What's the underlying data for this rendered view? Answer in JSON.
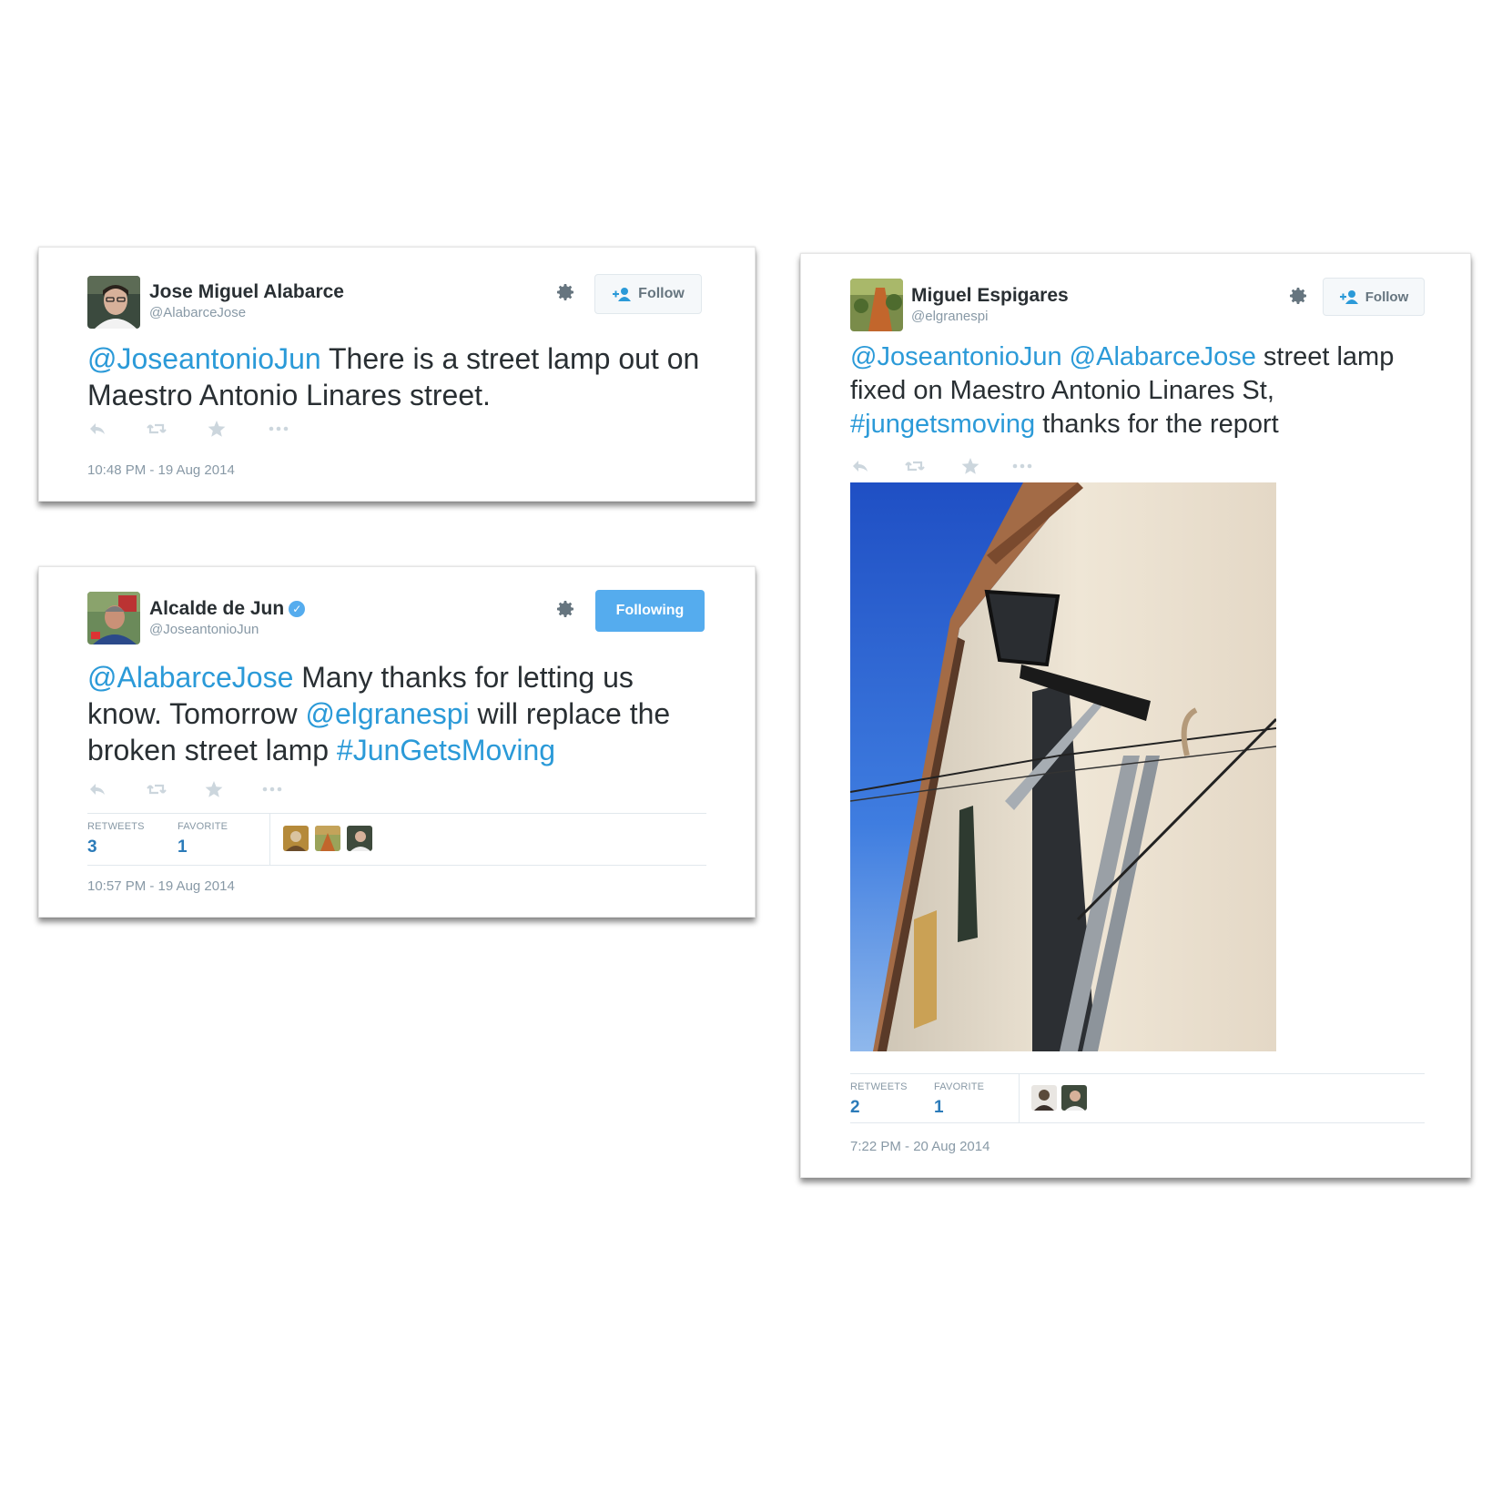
{
  "tweets": [
    {
      "name": "Jose Miguel Alabarce",
      "handle": "@AlabarceJose",
      "verified": false,
      "follow_label": "Follow",
      "text": [
        {
          "type": "mention",
          "text": "@JoseantonioJun"
        },
        {
          "type": "text",
          "text": " There is a street lamp out on Maestro Antonio Linares street."
        }
      ],
      "timestamp": "10:48 PM - 19 Aug 2014"
    },
    {
      "name": "Alcalde de Jun",
      "handle": "@JoseantonioJun",
      "verified": true,
      "follow_label": "Following",
      "text": [
        {
          "type": "mention",
          "text": "@AlabarceJose"
        },
        {
          "type": "text",
          "text": " Many thanks for letting us know. Tomorrow "
        },
        {
          "type": "mention",
          "text": "@elgranespi"
        },
        {
          "type": "text",
          "text": " will replace the broken street lamp "
        },
        {
          "type": "hashtag",
          "text": "#JunGetsMoving"
        }
      ],
      "stats": {
        "retweets_label": "RETWEETS",
        "retweets": "3",
        "favorites_label": "FAVORITE",
        "favorites": "1"
      },
      "timestamp": "10:57 PM - 19 Aug 2014"
    },
    {
      "name": "Miguel Espigares",
      "handle": "@elgranespi",
      "verified": false,
      "follow_label": "Follow",
      "text": [
        {
          "type": "mention",
          "text": "@JoseantonioJun"
        },
        {
          "type": "text",
          "text": " "
        },
        {
          "type": "mention",
          "text": "@AlabarceJose"
        },
        {
          "type": "text",
          "text": " street lamp fixed on Maestro Antonio Linares St, "
        },
        {
          "type": "hashtag",
          "text": "#jungetsmoving"
        },
        {
          "type": "text",
          "text": " thanks for the report"
        }
      ],
      "stats": {
        "retweets_label": "RETWEETS",
        "retweets": "2",
        "favorites_label": "FAVORITE",
        "favorites": "1"
      },
      "timestamp": "7:22 PM - 20 Aug 2014"
    }
  ],
  "icons": {
    "reply": "reply-icon",
    "retweet": "retweet-icon",
    "favorite": "star-icon",
    "more": "more-icon",
    "settings": "gear-icon",
    "follow": "add-user-icon",
    "verified": "verified-badge-icon"
  },
  "colors": {
    "link": "#2b9ad8",
    "following_button": "#55acee",
    "muted": "#8899a6",
    "stat_value": "#2b7bb9"
  }
}
